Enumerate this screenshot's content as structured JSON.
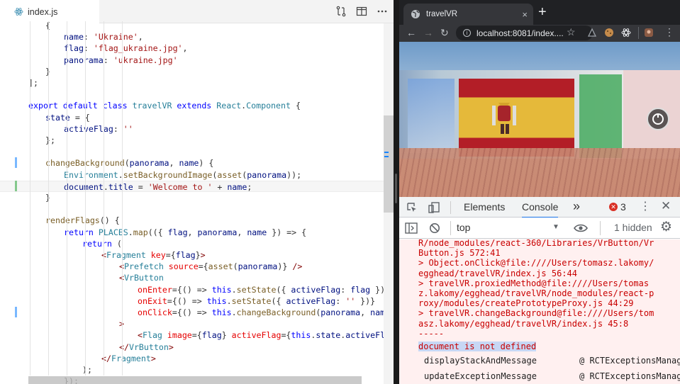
{
  "editor": {
    "tab_label": "index.js",
    "lines": [
      [
        [
          "p",
          "{"
        ]
      ],
      [
        [
          "v",
          "name"
        ],
        [
          "p",
          ": "
        ],
        [
          "s",
          "'Ukraine'"
        ],
        [
          "p",
          ","
        ]
      ],
      [
        [
          "v",
          "flag"
        ],
        [
          "p",
          ": "
        ],
        [
          "s",
          "'flag_ukraine.jpg'"
        ],
        [
          "p",
          ","
        ]
      ],
      [
        [
          "v",
          "panorama"
        ],
        [
          "p",
          ": "
        ],
        [
          "s",
          "'ukraine.jpg'"
        ]
      ],
      [
        [
          "p",
          "}"
        ]
      ],
      [
        [
          "p",
          "];"
        ]
      ],
      [],
      [
        [
          "k",
          "export default class "
        ],
        [
          "c",
          "travelVR"
        ],
        [
          "k",
          " extends "
        ],
        [
          "c",
          "React"
        ],
        [
          "p",
          "."
        ],
        [
          "c",
          "Component"
        ],
        [
          "p",
          " {"
        ]
      ],
      [
        [
          "v",
          "state"
        ],
        [
          "p",
          " = {"
        ]
      ],
      [
        [
          "v",
          "activeFlag"
        ],
        [
          "p",
          ": "
        ],
        [
          "s",
          "''"
        ]
      ],
      [
        [
          "p",
          "};"
        ]
      ],
      [],
      [
        [
          "f",
          "changeBackground"
        ],
        [
          "p",
          "("
        ],
        [
          "v",
          "panorama"
        ],
        [
          "p",
          ", "
        ],
        [
          "v",
          "name"
        ],
        [
          "p",
          ") {"
        ]
      ],
      [
        [
          "c",
          "Environment"
        ],
        [
          "p",
          "."
        ],
        [
          "f",
          "setBackgroundImage"
        ],
        [
          "p",
          "("
        ],
        [
          "f",
          "asset"
        ],
        [
          "p",
          "("
        ],
        [
          "v",
          "panorama"
        ],
        [
          "p",
          "));"
        ]
      ],
      [
        [
          "v",
          "document"
        ],
        [
          "p",
          "."
        ],
        [
          "v",
          "title"
        ],
        [
          "p",
          " = "
        ],
        [
          "s",
          "'Welcome to '"
        ],
        [
          "p",
          " + "
        ],
        [
          "v",
          "name"
        ],
        [
          "p",
          ";"
        ]
      ],
      [
        [
          "p",
          "}"
        ]
      ],
      [],
      [
        [
          "f",
          "renderFlags"
        ],
        [
          "p",
          "() {"
        ]
      ],
      [
        [
          "k",
          "return "
        ],
        [
          "c",
          "PLACES"
        ],
        [
          "p",
          "."
        ],
        [
          "f",
          "map"
        ],
        [
          "p",
          "(({ "
        ],
        [
          "v",
          "flag"
        ],
        [
          "p",
          ", "
        ],
        [
          "v",
          "panorama"
        ],
        [
          "p",
          ", "
        ],
        [
          "v",
          "name"
        ],
        [
          "p",
          " }) => {"
        ]
      ],
      [
        [
          "k",
          "return"
        ],
        [
          "p",
          " ("
        ]
      ],
      [
        [
          "t",
          "<"
        ],
        [
          "c",
          "Fragment"
        ],
        [
          "a",
          " key"
        ],
        [
          "p",
          "={"
        ],
        [
          "v",
          "flag"
        ],
        [
          "p",
          "}"
        ],
        [
          "t",
          ">"
        ]
      ],
      [
        [
          "t",
          "<"
        ],
        [
          "c",
          "Prefetch"
        ],
        [
          "a",
          " source"
        ],
        [
          "p",
          "={"
        ],
        [
          "f",
          "asset"
        ],
        [
          "p",
          "("
        ],
        [
          "v",
          "panorama"
        ],
        [
          "p",
          ")} "
        ],
        [
          "t",
          "/>"
        ]
      ],
      [
        [
          "t",
          "<"
        ],
        [
          "c",
          "VrButton"
        ]
      ],
      [
        [
          "a",
          "onEnter"
        ],
        [
          "p",
          "={() => "
        ],
        [
          "k",
          "this"
        ],
        [
          "p",
          "."
        ],
        [
          "f",
          "setState"
        ],
        [
          "p",
          "({ "
        ],
        [
          "v",
          "activeFlag"
        ],
        [
          "p",
          ": "
        ],
        [
          "v",
          "flag"
        ],
        [
          "p",
          " })}"
        ]
      ],
      [
        [
          "a",
          "onExit"
        ],
        [
          "p",
          "={() => "
        ],
        [
          "k",
          "this"
        ],
        [
          "p",
          "."
        ],
        [
          "f",
          "setState"
        ],
        [
          "p",
          "({ "
        ],
        [
          "v",
          "activeFlag"
        ],
        [
          "p",
          ": "
        ],
        [
          "s",
          "''"
        ],
        [
          "p",
          " })}"
        ]
      ],
      [
        [
          "a",
          "onClick"
        ],
        [
          "p",
          "={() => "
        ],
        [
          "k",
          "this"
        ],
        [
          "p",
          "."
        ],
        [
          "f",
          "changeBackground"
        ],
        [
          "p",
          "("
        ],
        [
          "v",
          "panorama"
        ],
        [
          "p",
          ", "
        ],
        [
          "v",
          "name"
        ],
        [
          "p",
          ")}"
        ]
      ],
      [
        [
          "t",
          ">"
        ]
      ],
      [
        [
          "t",
          "<"
        ],
        [
          "c",
          "Flag"
        ],
        [
          "a",
          " image"
        ],
        [
          "p",
          "={"
        ],
        [
          "v",
          "flag"
        ],
        [
          "p",
          "}"
        ],
        [
          "a",
          " activeFlag"
        ],
        [
          "p",
          "={"
        ],
        [
          "k",
          "this"
        ],
        [
          "p",
          "."
        ],
        [
          "v",
          "state"
        ],
        [
          "p",
          "."
        ],
        [
          "v",
          "activeFlag"
        ],
        [
          "p",
          "} "
        ],
        [
          "t",
          "/>"
        ]
      ],
      [
        [
          "t",
          "</"
        ],
        [
          "c",
          "VrButton"
        ],
        [
          "t",
          ">"
        ]
      ],
      [
        [
          "t",
          "</"
        ],
        [
          "c",
          "Fragment"
        ],
        [
          "t",
          ">"
        ]
      ],
      [
        [
          "p",
          ");"
        ]
      ],
      [
        [
          "p",
          "});"
        ]
      ]
    ]
  },
  "browser": {
    "tab_title": "travelVR",
    "tab_close": "×",
    "new_tab": "+",
    "url": "localhost:8081/index....",
    "devtools": {
      "tabs": [
        "Elements",
        "Console"
      ],
      "more": "»",
      "error_count": "3",
      "context": "top",
      "hidden": "1 hidden",
      "console_lines": [
        "R/node_modules/react-360/Libraries/VrButton/Vr",
        "Button.js 572:41",
        "> Object.onClick@file:////Users/tomasz.lakomy/",
        "egghead/travelVR/index.js 56:44",
        "> travelVR.proxiedMethod@file:////Users/tomas",
        "z.lakomy/egghead/travelVR/node_modules/react-p",
        "roxy/modules/createPrototypeProxy.js 44:29",
        "> travelVR.changeBackground@file:////Users/tom",
        "asz.lakomy/egghead/travelVR/index.js 45:8",
        "-----"
      ],
      "error_message": "document is not defined",
      "stack": [
        {
          "fn": "displayStackAndMessage",
          "src": "@ RCTExceptionsManag"
        },
        {
          "fn": "updateExceptionMessage",
          "src": "@ RCTExceptionsManag"
        }
      ]
    }
  }
}
